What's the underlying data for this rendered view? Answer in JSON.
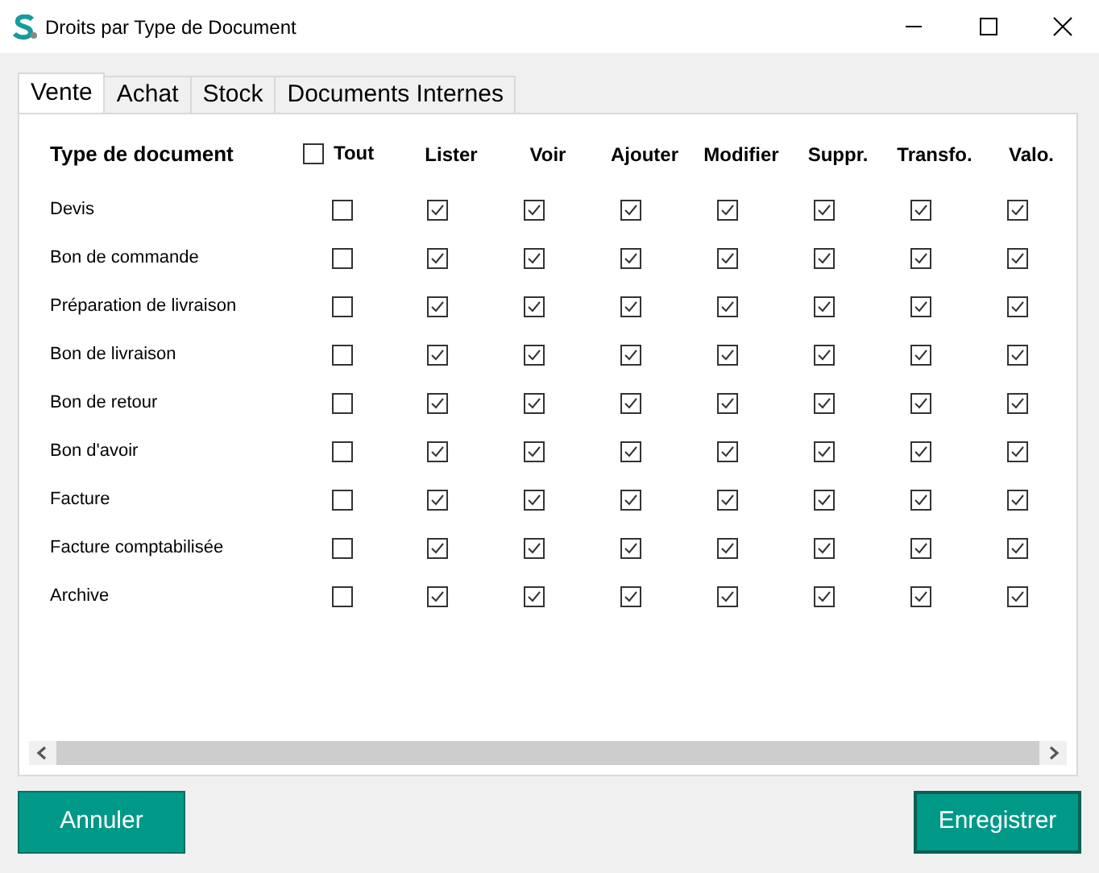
{
  "window": {
    "title": "Droits par Type de Document"
  },
  "tabs": [
    {
      "label": "Vente",
      "selected": true
    },
    {
      "label": "Achat",
      "selected": false
    },
    {
      "label": "Stock",
      "selected": false
    },
    {
      "label": "Documents Internes",
      "selected": false
    }
  ],
  "table": {
    "first_column": "Type de document",
    "all_toggle": {
      "label": "Tout",
      "checked": false
    },
    "columns": [
      "Lister",
      "Voir",
      "Ajouter",
      "Modifier",
      "Suppr.",
      "Transfo.",
      "Valo."
    ],
    "rows": [
      {
        "label": "Devis",
        "all": false,
        "cells": [
          true,
          true,
          true,
          true,
          true,
          true,
          true
        ]
      },
      {
        "label": "Bon de commande",
        "all": false,
        "cells": [
          true,
          true,
          true,
          true,
          true,
          true,
          true
        ]
      },
      {
        "label": "Préparation de livraison",
        "all": false,
        "cells": [
          true,
          true,
          true,
          true,
          true,
          true,
          true
        ]
      },
      {
        "label": "Bon de livraison",
        "all": false,
        "cells": [
          true,
          true,
          true,
          true,
          true,
          true,
          true
        ]
      },
      {
        "label": "Bon de retour",
        "all": false,
        "cells": [
          true,
          true,
          true,
          true,
          true,
          true,
          true
        ]
      },
      {
        "label": "Bon d'avoir",
        "all": false,
        "cells": [
          true,
          true,
          true,
          true,
          true,
          true,
          true
        ]
      },
      {
        "label": "Facture",
        "all": false,
        "cells": [
          true,
          true,
          true,
          true,
          true,
          true,
          true
        ]
      },
      {
        "label": "Facture comptabilisée",
        "all": false,
        "cells": [
          true,
          true,
          true,
          true,
          true,
          true,
          true
        ]
      },
      {
        "label": "Archive",
        "all": false,
        "cells": [
          true,
          true,
          true,
          true,
          true,
          true,
          true
        ]
      }
    ]
  },
  "buttons": {
    "cancel": "Annuler",
    "save": "Enregistrer"
  }
}
